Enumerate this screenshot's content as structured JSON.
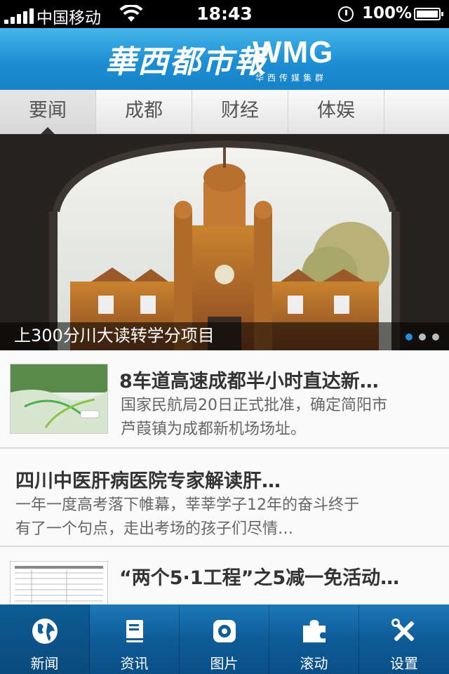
{
  "status_bar": {
    "carrier": "中国移动",
    "time": "18:43",
    "battery": "100%"
  },
  "header": {
    "logo_cn": "華西都市報",
    "logo_en": "WMG",
    "logo_sub": "华西传媒集群"
  },
  "tabs": [
    {
      "label": "要闻",
      "active": true
    },
    {
      "label": "成都",
      "active": false
    },
    {
      "label": "财经",
      "active": false
    },
    {
      "label": "体娱",
      "active": false
    }
  ],
  "hero": {
    "caption": "上300分川大读转学分项目",
    "page_count": 3,
    "active_page": 1
  },
  "news": [
    {
      "title": "8车道高速成都半小时直达新…",
      "summary_lines": [
        "国家民航局20日正式批准，确定简阳市",
        "芦葭镇为成都新机场场址。"
      ],
      "has_thumb": true
    },
    {
      "title": "四川中医肝病医院专家解读肝…",
      "summary_lines": [
        "一年一度高考落下帷幕，莘莘学子12年的奋斗终于",
        "有了一个句点，走出考场的孩子们尽情…"
      ],
      "has_thumb": false
    },
    {
      "title": "“两个5·1工程”之5减一免活动…",
      "summary_lines": [],
      "has_thumb": true
    }
  ],
  "tabbar": [
    {
      "label": "新闻",
      "icon": "globe-icon",
      "active": true
    },
    {
      "label": "资讯",
      "icon": "book-icon",
      "active": false
    },
    {
      "label": "图片",
      "icon": "camera-icon",
      "active": false
    },
    {
      "label": "滚动",
      "icon": "puzzle-icon",
      "active": false
    },
    {
      "label": "设置",
      "icon": "tools-icon",
      "active": false
    }
  ],
  "colors": {
    "header_blue": "#1e8ed3",
    "tabbar_blue": "#0e5c98",
    "dot_active": "#1e90e0"
  }
}
